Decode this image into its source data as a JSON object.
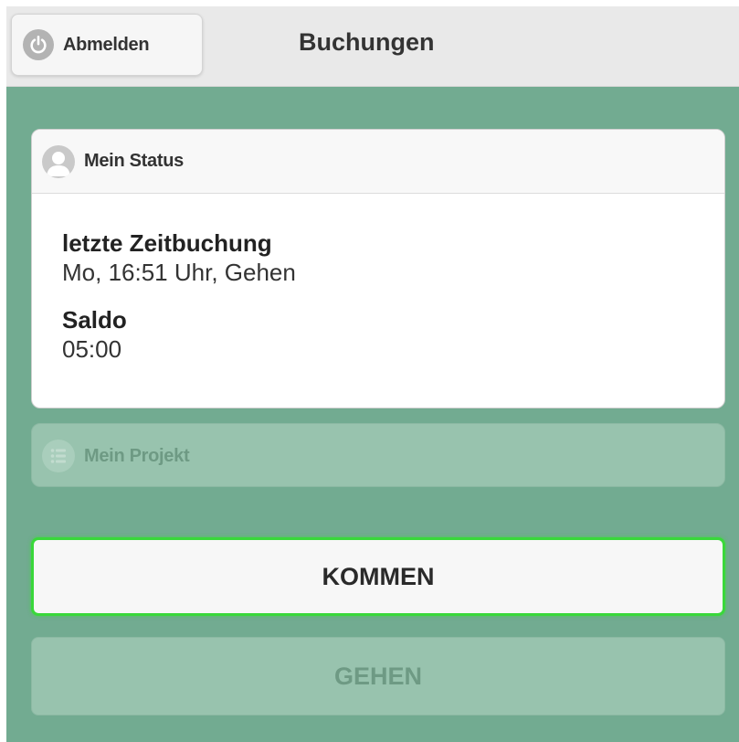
{
  "header": {
    "logout_label": "Abmelden",
    "title": "Buchungen",
    "logout_icon": "power-icon"
  },
  "status_panel": {
    "title": "Mein Status",
    "icon": "user-icon",
    "last_booking_label": "letzte Zeitbuchung",
    "last_booking_value": "Mo, 16:51 Uhr, Gehen",
    "balance_label": "Saldo",
    "balance_value": "05:00"
  },
  "project_panel": {
    "title": "Mein Projekt",
    "icon": "list-icon",
    "disabled": true
  },
  "actions": {
    "kommen_label": "KOMMEN",
    "gehen_label": "GEHEN",
    "gehen_disabled": true
  },
  "colors": {
    "background": "#72ab91",
    "header": "#e9e9e9",
    "kommen_border": "#39d83a",
    "disabled_fill": "#98c3ae"
  }
}
